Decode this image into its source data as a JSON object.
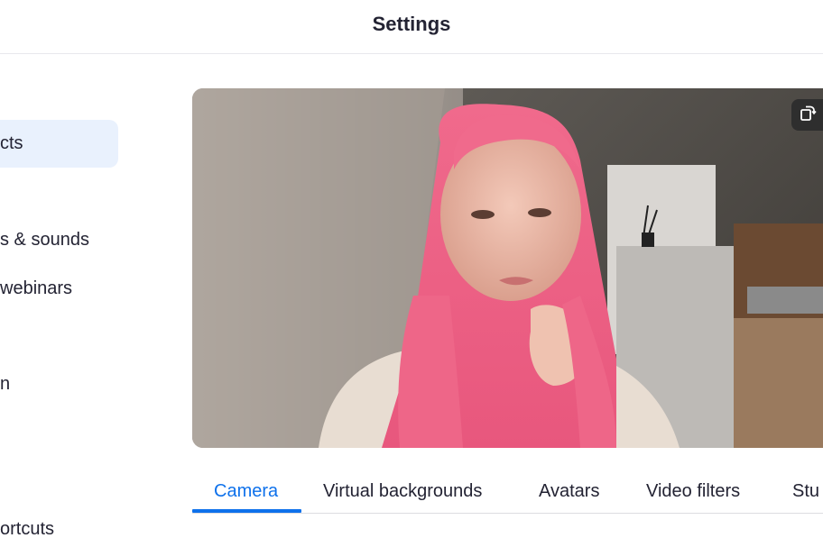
{
  "window": {
    "title": "Settings"
  },
  "sidebar": {
    "items": [
      {
        "label": "cts",
        "active": true
      },
      {
        "label": "s & sounds"
      },
      {
        "label": "webinars"
      },
      {
        "label": "n"
      },
      {
        "label": "ortcuts"
      }
    ]
  },
  "preview": {
    "rotate_icon": "rotate-camera-icon"
  },
  "tabs": [
    {
      "label": "Camera",
      "active": true
    },
    {
      "label": "Virtual backgrounds"
    },
    {
      "label": "Avatars"
    },
    {
      "label": "Video filters"
    },
    {
      "label": "Stu"
    }
  ],
  "colors": {
    "accent": "#0e71eb",
    "active_nav_bg": "#e9f1fd",
    "text": "#232333"
  }
}
